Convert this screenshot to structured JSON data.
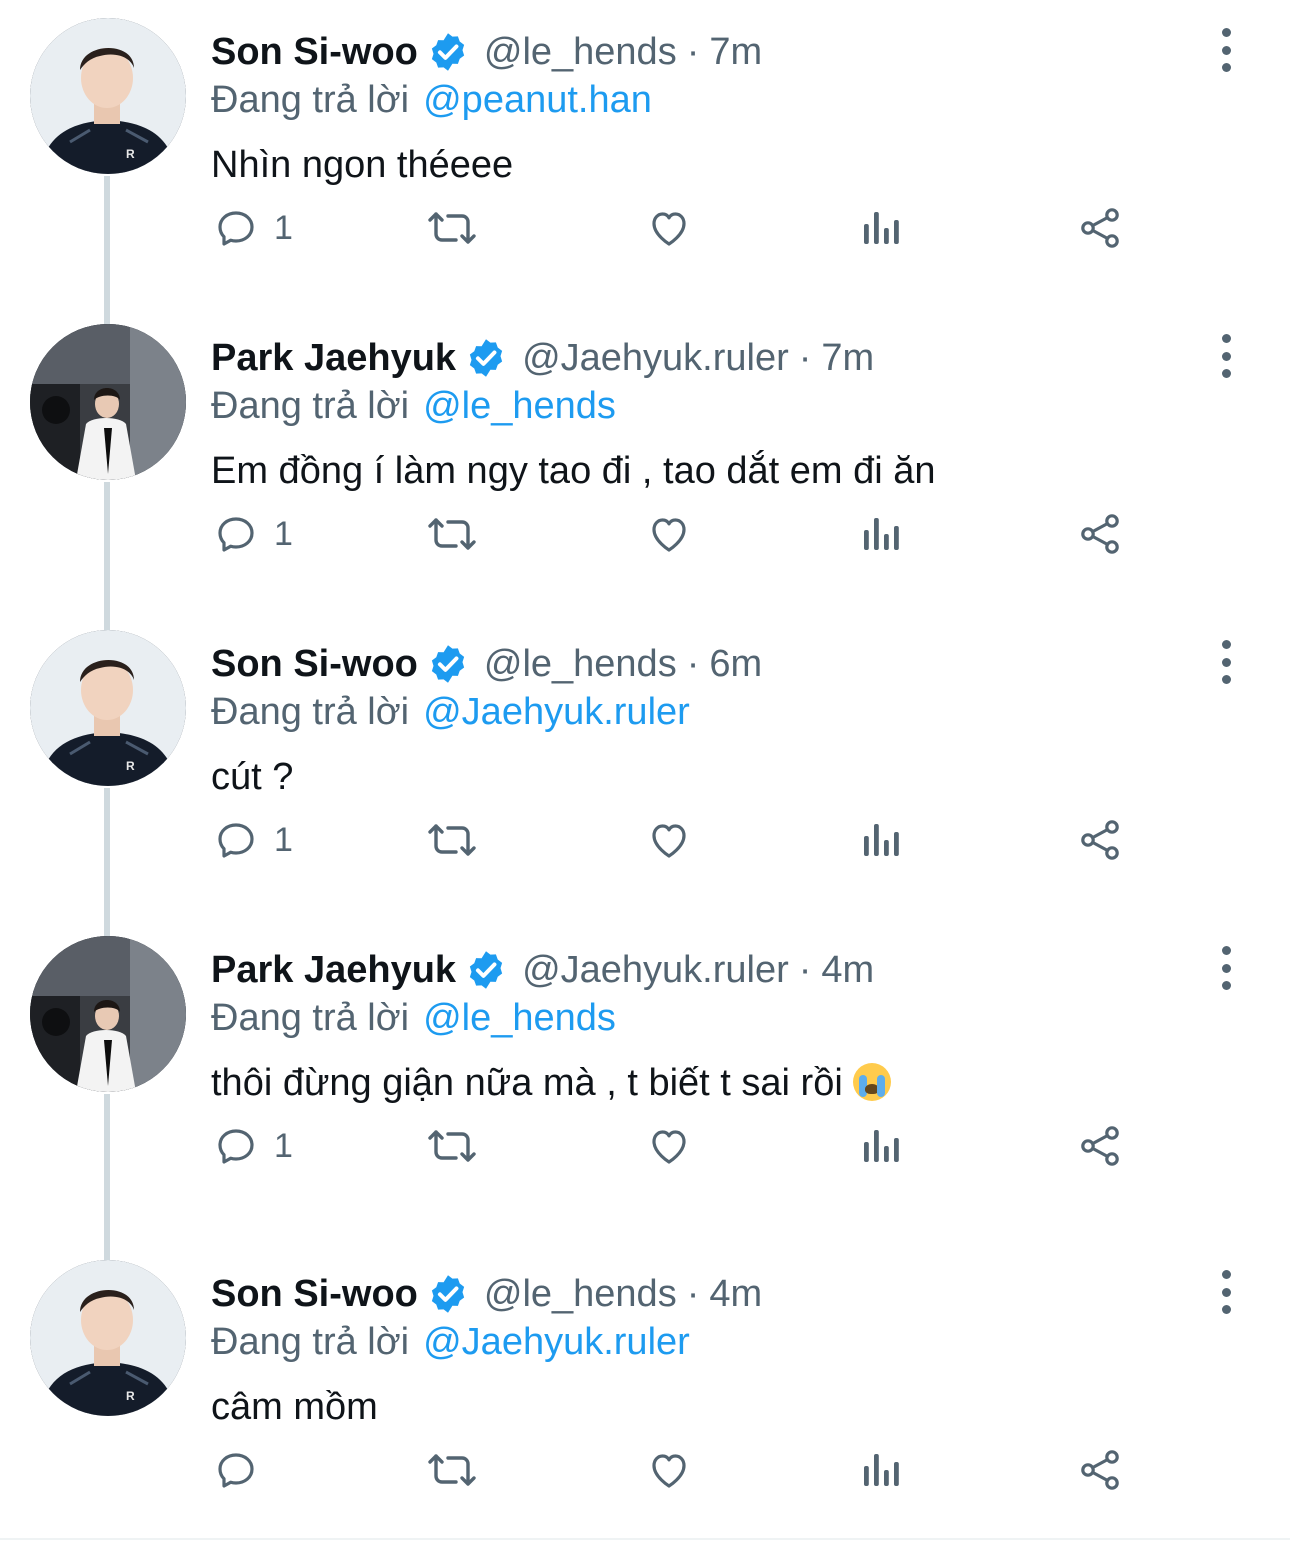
{
  "colors": {
    "accent": "#1d9bf0",
    "secondary_text": "#536471",
    "primary_text": "#0f1419",
    "thread_line": "#cfd9de"
  },
  "reply_prefix": "Đang trả lời",
  "tweets": [
    {
      "name": "Son Si-woo",
      "handle": "@le_hends",
      "separator": "·",
      "time": "7m",
      "reply_to": "@peanut.han",
      "text": "Nhìn ngon théeee",
      "reply_count": "1",
      "avatar_icon": "avatar-son-si-woo"
    },
    {
      "name": "Park Jaehyuk",
      "handle": "@Jaehyuk.ruler",
      "separator": "·",
      "time": "7m",
      "reply_to": "@le_hends",
      "text": "Em đồng í làm ngy tao đi , tao dắt em đi ăn",
      "reply_count": "1",
      "avatar_icon": "avatar-park-jaehyuk"
    },
    {
      "name": "Son Si-woo",
      "handle": "@le_hends",
      "separator": "·",
      "time": "6m",
      "reply_to": "@Jaehyuk.ruler",
      "text": "cút ?",
      "reply_count": "1",
      "avatar_icon": "avatar-son-si-woo"
    },
    {
      "name": "Park Jaehyuk",
      "handle": "@Jaehyuk.ruler",
      "separator": "·",
      "time": "4m",
      "reply_to": "@le_hends",
      "text": "thôi đừng giận nữa mà , t biết t sai rồi",
      "emoji": "loudly-crying-face",
      "reply_count": "1",
      "avatar_icon": "avatar-park-jaehyuk"
    },
    {
      "name": "Son Si-woo",
      "handle": "@le_hends",
      "separator": "·",
      "time": "4m",
      "reply_to": "@Jaehyuk.ruler",
      "text": "câm mồm",
      "reply_count": "",
      "avatar_icon": "avatar-son-si-woo"
    }
  ],
  "action_icons": [
    "reply-icon",
    "retweet-icon",
    "like-icon",
    "views-icon",
    "share-icon"
  ]
}
